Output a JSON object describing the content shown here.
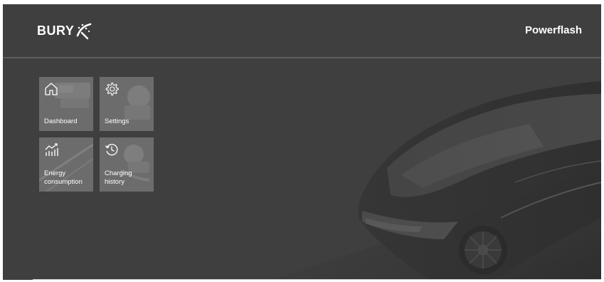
{
  "app": {
    "logo_text": "BURY",
    "title": "Powerflash"
  },
  "tiles": [
    {
      "label": "Dashboard",
      "icon": "home-icon"
    },
    {
      "label": "Settings",
      "icon": "gear-icon"
    },
    {
      "label": "Energy consumption",
      "icon": "energy-chart-icon"
    },
    {
      "label": "Charging history",
      "icon": "history-clock-icon"
    }
  ],
  "colors": {
    "background": "#3f3f3f",
    "tile": "#787878",
    "text": "#ffffff"
  }
}
